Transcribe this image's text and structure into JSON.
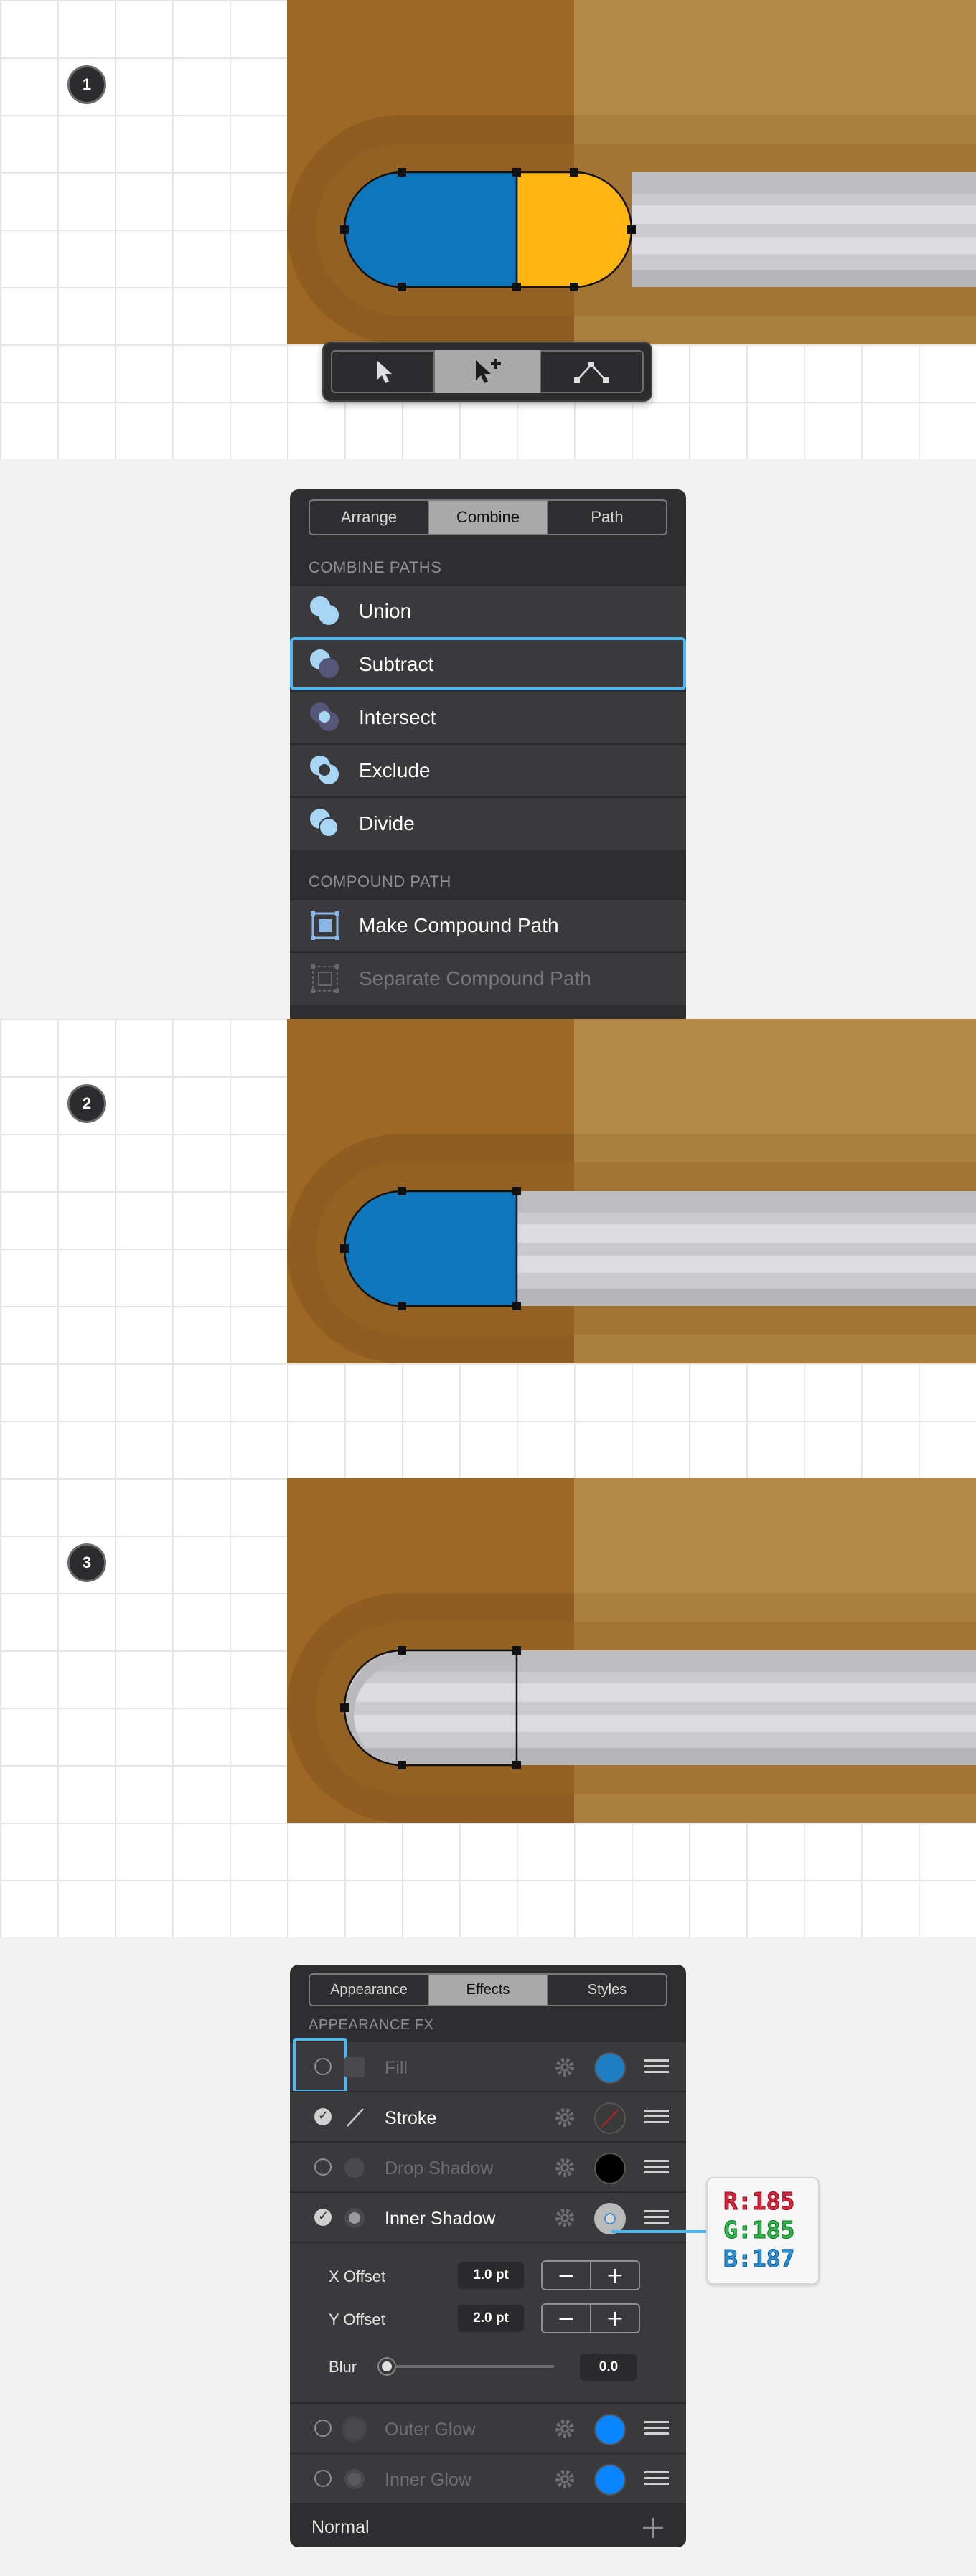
{
  "steps": [
    {
      "number": "1"
    },
    {
      "number": "2"
    },
    {
      "number": "3"
    }
  ],
  "toolbar": {
    "tools": [
      {
        "name": "direct-selection-tool",
        "icon": "arrow-pointer-icon"
      },
      {
        "name": "node-add-selection-tool",
        "icon": "arrow-plus-icon"
      },
      {
        "name": "path-tool",
        "icon": "path-nodes-icon"
      }
    ],
    "active_index": 1
  },
  "combine_panel": {
    "tabs": [
      "Arrange",
      "Combine",
      "Path"
    ],
    "active_tab": "Combine",
    "combine_title": "COMBINE PATHS",
    "items": [
      {
        "label": "Union",
        "icon": "union-icon"
      },
      {
        "label": "Subtract",
        "icon": "subtract-icon",
        "selected": true
      },
      {
        "label": "Intersect",
        "icon": "intersect-icon"
      },
      {
        "label": "Exclude",
        "icon": "exclude-icon"
      },
      {
        "label": "Divide",
        "icon": "divide-icon"
      }
    ],
    "compound_title": "COMPOUND PATH",
    "compound_items": [
      {
        "label": "Make Compound Path",
        "icon": "make-compound-icon",
        "enabled": true
      },
      {
        "label": "Separate Compound Path",
        "icon": "separate-compound-icon",
        "enabled": false
      }
    ]
  },
  "effects_panel": {
    "tabs": [
      "Appearance",
      "Effects",
      "Styles"
    ],
    "active_tab": "Effects",
    "section_title": "APPEARANCE FX",
    "rows": [
      {
        "label": "Fill",
        "enabled": false,
        "color": "#1e7fc3"
      },
      {
        "label": "Stroke",
        "enabled": true,
        "color": "#3a3a3a"
      },
      {
        "label": "Drop Shadow",
        "enabled": false,
        "color": "#000000"
      },
      {
        "label": "Inner Shadow",
        "enabled": true,
        "color": "#b9bbbb"
      }
    ],
    "inner_shadow": {
      "x_offset_label": "X Offset",
      "x_offset_value": "1.0 pt",
      "y_offset_label": "Y Offset",
      "y_offset_value": "2.0 pt",
      "blur_label": "Blur",
      "blur_value": "0.0"
    },
    "rows_after": [
      {
        "label": "Outer Glow",
        "enabled": false,
        "color": "#0a84ff"
      },
      {
        "label": "Inner Glow",
        "enabled": false,
        "color": "#0a84ff"
      }
    ],
    "blend_mode": "Normal"
  },
  "rgb_callout": {
    "r": "R:185",
    "g": "G:185",
    "b": "B:187"
  },
  "colors": {
    "blue_shape": "#0f76bc",
    "yellow_shape": "#ffb612",
    "wood_dark": "#9c6826",
    "wood_light": "#b48a46",
    "highlight": "#4fb7ef"
  }
}
